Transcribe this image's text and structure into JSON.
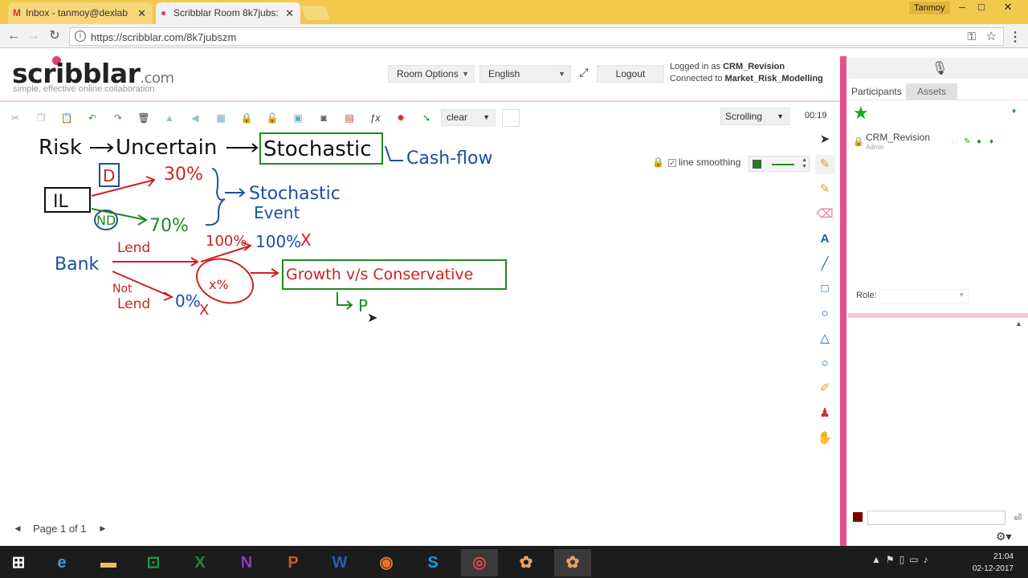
{
  "browser": {
    "tabs": [
      {
        "label": "Inbox - tanmoy@dexlab",
        "icon": "M"
      },
      {
        "label": "Scribblar Room 8k7jubs:",
        "icon": "s"
      }
    ],
    "user": "Tanmoy",
    "url": "https://scribblar.com/8k7jubszm",
    "window_controls": [
      "–",
      "□",
      "✕"
    ]
  },
  "header": {
    "logo_main": "scribblar",
    "logo_suffix": ".com",
    "tagline": "simple, effective online collaboration",
    "room_options": "Room Options",
    "language": "English",
    "logout": "Logout",
    "logged_in_prefix": "Logged in as",
    "logged_in_user": "CRM_Revision",
    "connected_prefix": "Connected to",
    "connected_room": "Market_Risk_Modelling"
  },
  "toolbar": {
    "clear_label": "clear",
    "scroll_mode": "Scrolling",
    "timer": "00:19"
  },
  "canvas": {
    "line_smoothing": "line smoothing",
    "accent_color": "#1e7d1e",
    "handwriting": {
      "row1": [
        "Risk",
        "Uncertain",
        "Stochastic",
        "Cash-flow"
      ],
      "d_label": "D",
      "nd_label": "ND",
      "il_label": "IL",
      "pct_30": "30%",
      "pct_70": "70%",
      "stochastic_event_1": "Stochastic",
      "stochastic_event_2": "Event",
      "bank": "Bank",
      "lend": "Lend",
      "not": "Not",
      "lend2": "Lend",
      "pct_100a": "100%",
      "pct_100b": "100%",
      "x1": "X",
      "xpct": "x%",
      "pct_0": "0%",
      "x2": "X",
      "growth": "Growth v/s Conservative",
      "p": "P"
    }
  },
  "pager": {
    "label": "Page 1 of 1"
  },
  "panel": {
    "tab_participants": "Participants",
    "tab_assets": "Assets",
    "participant_name": "CRM_Revision",
    "participant_role": "Admin",
    "role_label": "Role:"
  },
  "taskbar": {
    "time": "21:04",
    "date": "02-12-2017"
  }
}
